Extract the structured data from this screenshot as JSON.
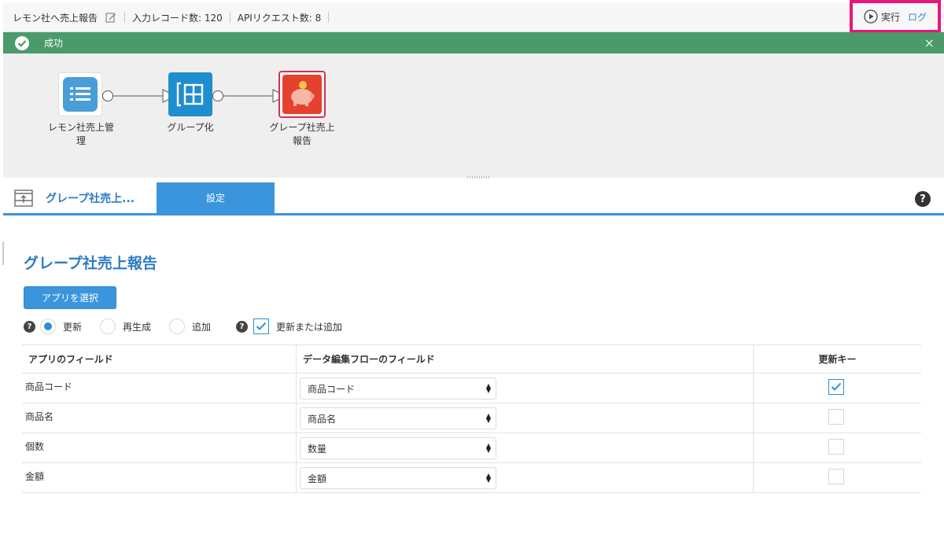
{
  "header": {
    "flow_name": "レモン社へ売上報告",
    "input_records": "入力レコード数: 120",
    "api_requests": "APIリクエスト数: 8",
    "run_label": "実行",
    "log_label": "ログ"
  },
  "status": {
    "message": "成功",
    "close": "×",
    "color": "#4b9a6b"
  },
  "flow": {
    "nodes": [
      {
        "label": "レモン社売上管\n理",
        "icon": "list-icon"
      },
      {
        "label": "グループ化",
        "icon": "group-icon"
      },
      {
        "label": "グレープ社売上\n報告",
        "icon": "piggy-bank-icon"
      }
    ]
  },
  "panel": {
    "title": "グレープ社売上...",
    "settings_tab": "設定",
    "help": "?"
  },
  "settings": {
    "app_title": "グレープ社売上報告",
    "select_app_button": "アプリを選択",
    "mode_options": [
      {
        "label": "更新",
        "selected": true
      },
      {
        "label": "再生成",
        "selected": false
      },
      {
        "label": "追加",
        "selected": false
      }
    ],
    "update_or_add": {
      "label": "更新または追加",
      "checked": true
    },
    "table": {
      "headers": [
        "アプリのフィールド",
        "データ編集フローのフィールド",
        "更新キー"
      ],
      "rows": [
        {
          "app_field": "商品コード",
          "flow_field": "商品コード",
          "update_key": true
        },
        {
          "app_field": "商品名",
          "flow_field": "商品名",
          "update_key": false
        },
        {
          "app_field": "個数",
          "flow_field": "数量",
          "update_key": false
        },
        {
          "app_field": "金額",
          "flow_field": "金額",
          "update_key": false
        }
      ]
    }
  },
  "colors": {
    "accent": "#3a95dd",
    "highlight": "#e8157b"
  }
}
